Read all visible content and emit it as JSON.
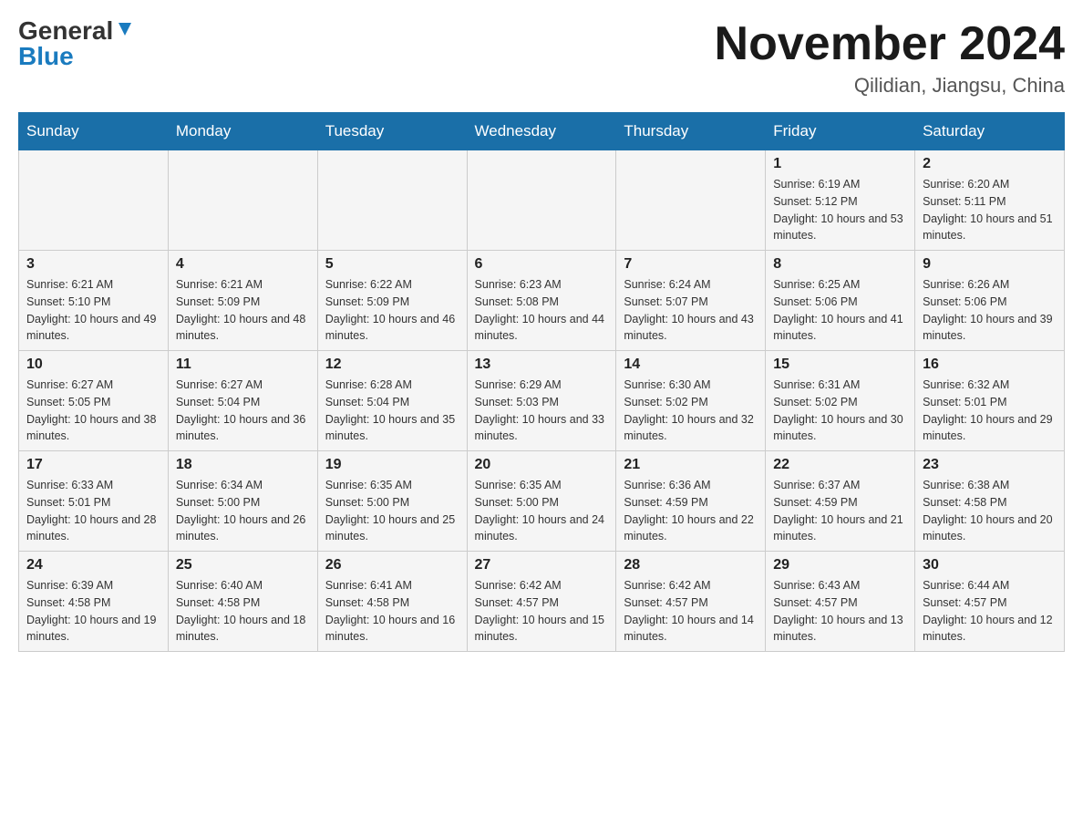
{
  "logo": {
    "general": "General",
    "blue": "Blue",
    "arrow": "▼"
  },
  "title": "November 2024",
  "location": "Qilidian, Jiangsu, China",
  "days_of_week": [
    "Sunday",
    "Monday",
    "Tuesday",
    "Wednesday",
    "Thursday",
    "Friday",
    "Saturday"
  ],
  "weeks": [
    [
      {
        "day": "",
        "info": ""
      },
      {
        "day": "",
        "info": ""
      },
      {
        "day": "",
        "info": ""
      },
      {
        "day": "",
        "info": ""
      },
      {
        "day": "",
        "info": ""
      },
      {
        "day": "1",
        "info": "Sunrise: 6:19 AM\nSunset: 5:12 PM\nDaylight: 10 hours and 53 minutes."
      },
      {
        "day": "2",
        "info": "Sunrise: 6:20 AM\nSunset: 5:11 PM\nDaylight: 10 hours and 51 minutes."
      }
    ],
    [
      {
        "day": "3",
        "info": "Sunrise: 6:21 AM\nSunset: 5:10 PM\nDaylight: 10 hours and 49 minutes."
      },
      {
        "day": "4",
        "info": "Sunrise: 6:21 AM\nSunset: 5:09 PM\nDaylight: 10 hours and 48 minutes."
      },
      {
        "day": "5",
        "info": "Sunrise: 6:22 AM\nSunset: 5:09 PM\nDaylight: 10 hours and 46 minutes."
      },
      {
        "day": "6",
        "info": "Sunrise: 6:23 AM\nSunset: 5:08 PM\nDaylight: 10 hours and 44 minutes."
      },
      {
        "day": "7",
        "info": "Sunrise: 6:24 AM\nSunset: 5:07 PM\nDaylight: 10 hours and 43 minutes."
      },
      {
        "day": "8",
        "info": "Sunrise: 6:25 AM\nSunset: 5:06 PM\nDaylight: 10 hours and 41 minutes."
      },
      {
        "day": "9",
        "info": "Sunrise: 6:26 AM\nSunset: 5:06 PM\nDaylight: 10 hours and 39 minutes."
      }
    ],
    [
      {
        "day": "10",
        "info": "Sunrise: 6:27 AM\nSunset: 5:05 PM\nDaylight: 10 hours and 38 minutes."
      },
      {
        "day": "11",
        "info": "Sunrise: 6:27 AM\nSunset: 5:04 PM\nDaylight: 10 hours and 36 minutes."
      },
      {
        "day": "12",
        "info": "Sunrise: 6:28 AM\nSunset: 5:04 PM\nDaylight: 10 hours and 35 minutes."
      },
      {
        "day": "13",
        "info": "Sunrise: 6:29 AM\nSunset: 5:03 PM\nDaylight: 10 hours and 33 minutes."
      },
      {
        "day": "14",
        "info": "Sunrise: 6:30 AM\nSunset: 5:02 PM\nDaylight: 10 hours and 32 minutes."
      },
      {
        "day": "15",
        "info": "Sunrise: 6:31 AM\nSunset: 5:02 PM\nDaylight: 10 hours and 30 minutes."
      },
      {
        "day": "16",
        "info": "Sunrise: 6:32 AM\nSunset: 5:01 PM\nDaylight: 10 hours and 29 minutes."
      }
    ],
    [
      {
        "day": "17",
        "info": "Sunrise: 6:33 AM\nSunset: 5:01 PM\nDaylight: 10 hours and 28 minutes."
      },
      {
        "day": "18",
        "info": "Sunrise: 6:34 AM\nSunset: 5:00 PM\nDaylight: 10 hours and 26 minutes."
      },
      {
        "day": "19",
        "info": "Sunrise: 6:35 AM\nSunset: 5:00 PM\nDaylight: 10 hours and 25 minutes."
      },
      {
        "day": "20",
        "info": "Sunrise: 6:35 AM\nSunset: 5:00 PM\nDaylight: 10 hours and 24 minutes."
      },
      {
        "day": "21",
        "info": "Sunrise: 6:36 AM\nSunset: 4:59 PM\nDaylight: 10 hours and 22 minutes."
      },
      {
        "day": "22",
        "info": "Sunrise: 6:37 AM\nSunset: 4:59 PM\nDaylight: 10 hours and 21 minutes."
      },
      {
        "day": "23",
        "info": "Sunrise: 6:38 AM\nSunset: 4:58 PM\nDaylight: 10 hours and 20 minutes."
      }
    ],
    [
      {
        "day": "24",
        "info": "Sunrise: 6:39 AM\nSunset: 4:58 PM\nDaylight: 10 hours and 19 minutes."
      },
      {
        "day": "25",
        "info": "Sunrise: 6:40 AM\nSunset: 4:58 PM\nDaylight: 10 hours and 18 minutes."
      },
      {
        "day": "26",
        "info": "Sunrise: 6:41 AM\nSunset: 4:58 PM\nDaylight: 10 hours and 16 minutes."
      },
      {
        "day": "27",
        "info": "Sunrise: 6:42 AM\nSunset: 4:57 PM\nDaylight: 10 hours and 15 minutes."
      },
      {
        "day": "28",
        "info": "Sunrise: 6:42 AM\nSunset: 4:57 PM\nDaylight: 10 hours and 14 minutes."
      },
      {
        "day": "29",
        "info": "Sunrise: 6:43 AM\nSunset: 4:57 PM\nDaylight: 10 hours and 13 minutes."
      },
      {
        "day": "30",
        "info": "Sunrise: 6:44 AM\nSunset: 4:57 PM\nDaylight: 10 hours and 12 minutes."
      }
    ]
  ]
}
